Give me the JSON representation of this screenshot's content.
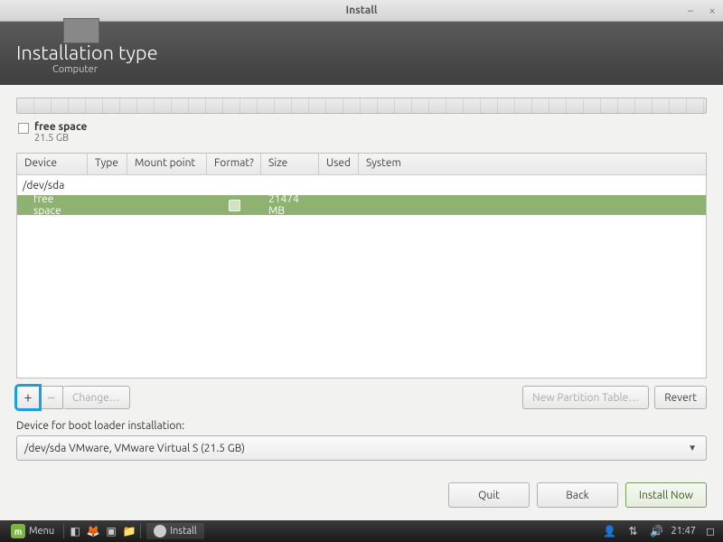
{
  "window": {
    "title": "Install"
  },
  "header": {
    "title": "Installation type",
    "subtitle": "Computer"
  },
  "freespace": {
    "label": "free space",
    "size": "21.5 GB"
  },
  "table": {
    "headers": {
      "device": "Device",
      "type": "Type",
      "mount": "Mount point",
      "format": "Format?",
      "size": "Size",
      "used": "Used",
      "system": "System"
    },
    "parent": "/dev/sda",
    "row": {
      "device": "free space",
      "size": "21474 MB"
    }
  },
  "toolbar": {
    "plus": "+",
    "minus": "−",
    "change": "Change…",
    "new_table": "New Partition Table…",
    "revert": "Revert"
  },
  "bootloader": {
    "label": "Device for boot loader installation:",
    "value": "/dev/sda VMware, VMware Virtual S (21.5 GB)"
  },
  "footer": {
    "quit": "Quit",
    "back": "Back",
    "install": "Install Now"
  },
  "taskbar": {
    "menu": "Menu",
    "task": "Install",
    "time": "21:47"
  }
}
